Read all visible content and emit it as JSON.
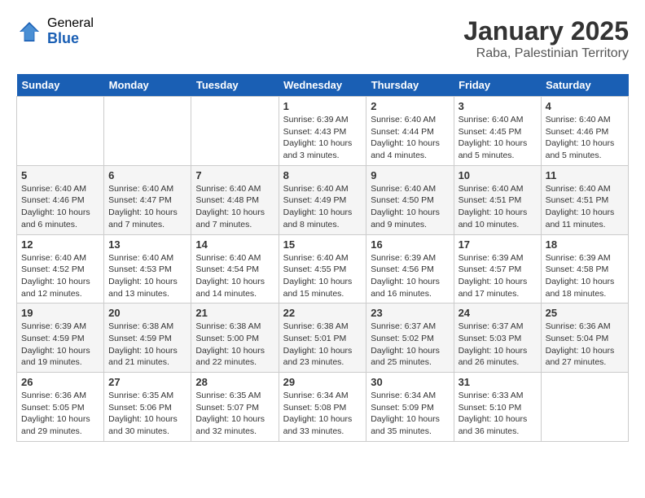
{
  "header": {
    "logo_general": "General",
    "logo_blue": "Blue",
    "title": "January 2025",
    "subtitle": "Raba, Palestinian Territory"
  },
  "weekdays": [
    "Sunday",
    "Monday",
    "Tuesday",
    "Wednesday",
    "Thursday",
    "Friday",
    "Saturday"
  ],
  "weeks": [
    [
      {
        "day": "",
        "info": ""
      },
      {
        "day": "",
        "info": ""
      },
      {
        "day": "",
        "info": ""
      },
      {
        "day": "1",
        "info": "Sunrise: 6:39 AM\nSunset: 4:43 PM\nDaylight: 10 hours\nand 3 minutes."
      },
      {
        "day": "2",
        "info": "Sunrise: 6:40 AM\nSunset: 4:44 PM\nDaylight: 10 hours\nand 4 minutes."
      },
      {
        "day": "3",
        "info": "Sunrise: 6:40 AM\nSunset: 4:45 PM\nDaylight: 10 hours\nand 5 minutes."
      },
      {
        "day": "4",
        "info": "Sunrise: 6:40 AM\nSunset: 4:46 PM\nDaylight: 10 hours\nand 5 minutes."
      }
    ],
    [
      {
        "day": "5",
        "info": "Sunrise: 6:40 AM\nSunset: 4:46 PM\nDaylight: 10 hours\nand 6 minutes."
      },
      {
        "day": "6",
        "info": "Sunrise: 6:40 AM\nSunset: 4:47 PM\nDaylight: 10 hours\nand 7 minutes."
      },
      {
        "day": "7",
        "info": "Sunrise: 6:40 AM\nSunset: 4:48 PM\nDaylight: 10 hours\nand 7 minutes."
      },
      {
        "day": "8",
        "info": "Sunrise: 6:40 AM\nSunset: 4:49 PM\nDaylight: 10 hours\nand 8 minutes."
      },
      {
        "day": "9",
        "info": "Sunrise: 6:40 AM\nSunset: 4:50 PM\nDaylight: 10 hours\nand 9 minutes."
      },
      {
        "day": "10",
        "info": "Sunrise: 6:40 AM\nSunset: 4:51 PM\nDaylight: 10 hours\nand 10 minutes."
      },
      {
        "day": "11",
        "info": "Sunrise: 6:40 AM\nSunset: 4:51 PM\nDaylight: 10 hours\nand 11 minutes."
      }
    ],
    [
      {
        "day": "12",
        "info": "Sunrise: 6:40 AM\nSunset: 4:52 PM\nDaylight: 10 hours\nand 12 minutes."
      },
      {
        "day": "13",
        "info": "Sunrise: 6:40 AM\nSunset: 4:53 PM\nDaylight: 10 hours\nand 13 minutes."
      },
      {
        "day": "14",
        "info": "Sunrise: 6:40 AM\nSunset: 4:54 PM\nDaylight: 10 hours\nand 14 minutes."
      },
      {
        "day": "15",
        "info": "Sunrise: 6:40 AM\nSunset: 4:55 PM\nDaylight: 10 hours\nand 15 minutes."
      },
      {
        "day": "16",
        "info": "Sunrise: 6:39 AM\nSunset: 4:56 PM\nDaylight: 10 hours\nand 16 minutes."
      },
      {
        "day": "17",
        "info": "Sunrise: 6:39 AM\nSunset: 4:57 PM\nDaylight: 10 hours\nand 17 minutes."
      },
      {
        "day": "18",
        "info": "Sunrise: 6:39 AM\nSunset: 4:58 PM\nDaylight: 10 hours\nand 18 minutes."
      }
    ],
    [
      {
        "day": "19",
        "info": "Sunrise: 6:39 AM\nSunset: 4:59 PM\nDaylight: 10 hours\nand 19 minutes."
      },
      {
        "day": "20",
        "info": "Sunrise: 6:38 AM\nSunset: 4:59 PM\nDaylight: 10 hours\nand 21 minutes."
      },
      {
        "day": "21",
        "info": "Sunrise: 6:38 AM\nSunset: 5:00 PM\nDaylight: 10 hours\nand 22 minutes."
      },
      {
        "day": "22",
        "info": "Sunrise: 6:38 AM\nSunset: 5:01 PM\nDaylight: 10 hours\nand 23 minutes."
      },
      {
        "day": "23",
        "info": "Sunrise: 6:37 AM\nSunset: 5:02 PM\nDaylight: 10 hours\nand 25 minutes."
      },
      {
        "day": "24",
        "info": "Sunrise: 6:37 AM\nSunset: 5:03 PM\nDaylight: 10 hours\nand 26 minutes."
      },
      {
        "day": "25",
        "info": "Sunrise: 6:36 AM\nSunset: 5:04 PM\nDaylight: 10 hours\nand 27 minutes."
      }
    ],
    [
      {
        "day": "26",
        "info": "Sunrise: 6:36 AM\nSunset: 5:05 PM\nDaylight: 10 hours\nand 29 minutes."
      },
      {
        "day": "27",
        "info": "Sunrise: 6:35 AM\nSunset: 5:06 PM\nDaylight: 10 hours\nand 30 minutes."
      },
      {
        "day": "28",
        "info": "Sunrise: 6:35 AM\nSunset: 5:07 PM\nDaylight: 10 hours\nand 32 minutes."
      },
      {
        "day": "29",
        "info": "Sunrise: 6:34 AM\nSunset: 5:08 PM\nDaylight: 10 hours\nand 33 minutes."
      },
      {
        "day": "30",
        "info": "Sunrise: 6:34 AM\nSunset: 5:09 PM\nDaylight: 10 hours\nand 35 minutes."
      },
      {
        "day": "31",
        "info": "Sunrise: 6:33 AM\nSunset: 5:10 PM\nDaylight: 10 hours\nand 36 minutes."
      },
      {
        "day": "",
        "info": ""
      }
    ]
  ]
}
